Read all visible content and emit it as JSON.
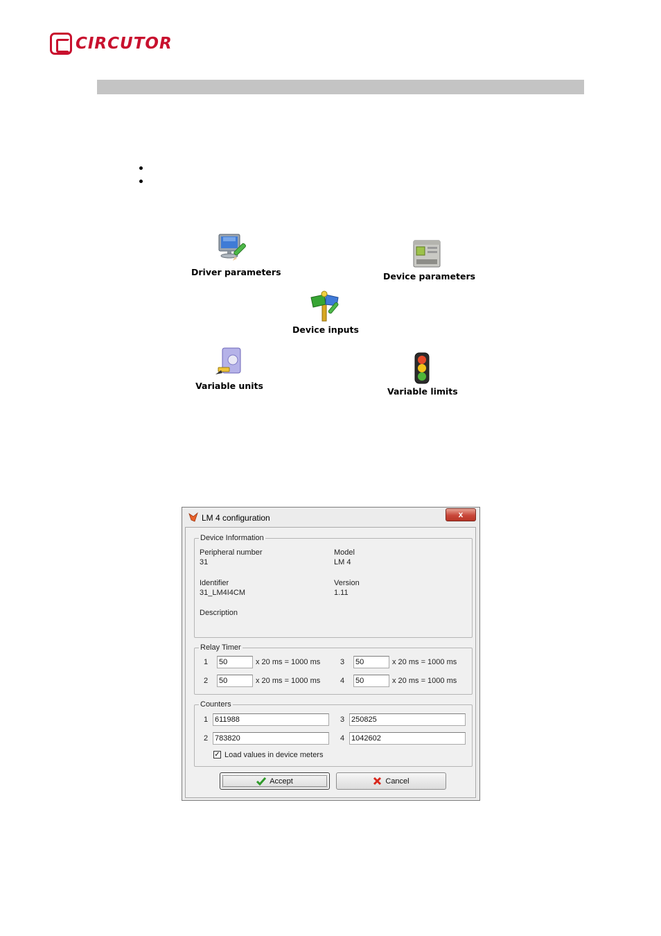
{
  "logo": {
    "text": "CIRCUTOR"
  },
  "icons": [
    {
      "name": "driver-parameters",
      "label": "Driver parameters"
    },
    {
      "name": "device-parameters",
      "label": "Device parameters"
    },
    {
      "name": "device-inputs",
      "label": "Device inputs"
    },
    {
      "name": "variable-units",
      "label": "Variable units"
    },
    {
      "name": "variable-limits",
      "label": "Variable limits"
    }
  ],
  "dialog": {
    "title": "LM 4 configuration",
    "close_label": "x",
    "device_info": {
      "legend": "Device Information",
      "peripheral_label": "Peripheral number",
      "peripheral_value": "31",
      "model_label": "Model",
      "model_value": "LM 4",
      "identifier_label": "Identifier",
      "identifier_value": "31_LM4I4CM",
      "version_label": "Version",
      "version_value": "1.11",
      "description_label": "Description"
    },
    "relay_timer": {
      "legend": "Relay Timer",
      "rows": [
        {
          "num": "1",
          "value": "50",
          "suffix": "x 20 ms = 1000 ms"
        },
        {
          "num": "2",
          "value": "50",
          "suffix": "x 20 ms = 1000 ms"
        },
        {
          "num": "3",
          "value": "50",
          "suffix": "x 20 ms = 1000 ms"
        },
        {
          "num": "4",
          "value": "50",
          "suffix": "x 20 ms = 1000 ms"
        }
      ]
    },
    "counters": {
      "legend": "Counters",
      "rows": [
        {
          "num": "1",
          "value": "611988"
        },
        {
          "num": "2",
          "value": "783820"
        },
        {
          "num": "3",
          "value": "250825"
        },
        {
          "num": "4",
          "value": "1042602"
        }
      ],
      "checkbox_label": "Load values in device meters",
      "checkbox_checked": true,
      "check_mark": "✓"
    },
    "accept_label": "Accept",
    "cancel_label": "Cancel"
  }
}
